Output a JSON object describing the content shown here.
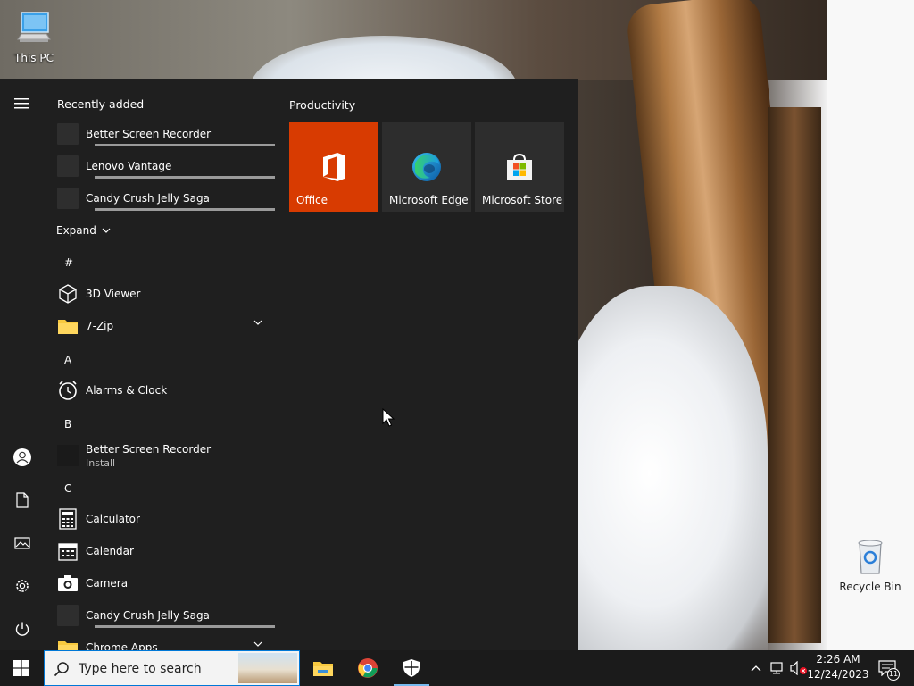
{
  "desktop": {
    "icons": [
      {
        "label": "This PC"
      },
      {
        "label": "Recycle Bin"
      }
    ]
  },
  "start_menu": {
    "recently_added_title": "Recently added",
    "recent": [
      {
        "label": "Better Screen Recorder",
        "progress": 1.0
      },
      {
        "label": "Lenovo Vantage",
        "progress": 1.0
      },
      {
        "label": "Candy Crush Jelly Saga",
        "progress": 1.0
      }
    ],
    "expand_label": "Expand",
    "sections": [
      {
        "letter": "#",
        "apps": [
          {
            "label": "3D Viewer",
            "icon": "cube-icon"
          },
          {
            "label": "7-Zip",
            "icon": "folder-icon",
            "expandable": true
          }
        ]
      },
      {
        "letter": "A",
        "apps": [
          {
            "label": "Alarms & Clock",
            "icon": "clock-icon"
          }
        ]
      },
      {
        "letter": "B",
        "apps": [
          {
            "label": "Better Screen Recorder",
            "sub": "Install",
            "icon": "placeholder-icon"
          }
        ]
      },
      {
        "letter": "C",
        "apps": [
          {
            "label": "Calculator",
            "icon": "calculator-icon"
          },
          {
            "label": "Calendar",
            "icon": "calendar-icon"
          },
          {
            "label": "Camera",
            "icon": "camera-icon"
          },
          {
            "label": "Candy Crush Jelly Saga",
            "icon": "placeholder-icon",
            "progress": 1.0
          },
          {
            "label": "Chrome Apps",
            "icon": "folder-icon",
            "expandable": true
          }
        ]
      }
    ],
    "tiles_group_title": "Productivity",
    "tiles": [
      {
        "label": "Office",
        "icon": "office-icon",
        "color": "#d83b01"
      },
      {
        "label": "Microsoft Edge",
        "icon": "edge-icon",
        "color": "#2d2d2d"
      },
      {
        "label": "Microsoft Store",
        "icon": "store-icon",
        "color": "#2d2d2d"
      }
    ],
    "rail": [
      "hamburger-icon",
      "user-icon",
      "documents-icon",
      "pictures-icon",
      "settings-icon",
      "power-icon"
    ]
  },
  "taskbar": {
    "search_placeholder": "Type here to search",
    "apps": [
      "file-explorer-icon",
      "chrome-icon",
      "security-icon"
    ],
    "clock_time": "2:26 AM",
    "clock_date": "12/24/2023",
    "notification_count": "11",
    "accent": "#0078d7"
  }
}
